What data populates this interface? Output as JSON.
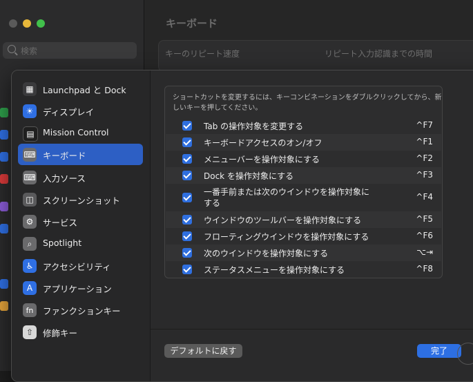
{
  "background": {
    "search_placeholder": "検索",
    "title": "キーボード",
    "label_repeat": "キーのリピート速度",
    "label_delay": "リピート入力認識までの時間"
  },
  "sidebar": {
    "items": [
      {
        "label": "Launchpad と Dock",
        "icon": "launchpad-icon",
        "color": "#3a3a3c",
        "glyph": "▦"
      },
      {
        "label": "ディスプレイ",
        "icon": "display-icon",
        "color": "#2f6fe3",
        "glyph": "☀"
      },
      {
        "label": "Mission Control",
        "icon": "mission-control-icon",
        "color": "#1f1f1f",
        "glyph": "▤"
      },
      {
        "label": "キーボード",
        "icon": "keyboard-icon",
        "color": "#6a6a6c",
        "glyph": "⌨",
        "selected": true
      },
      {
        "label": "入力ソース",
        "icon": "input-sources-icon",
        "color": "#6a6a6c",
        "glyph": "⌨"
      },
      {
        "label": "スクリーンショット",
        "icon": "screenshot-icon",
        "color": "#5a5a5c",
        "glyph": "◫"
      },
      {
        "label": "サービス",
        "icon": "services-icon",
        "color": "#6a6a6c",
        "glyph": "⚙"
      },
      {
        "label": "Spotlight",
        "icon": "spotlight-icon",
        "color": "#6a6a6c",
        "glyph": "⌕"
      },
      {
        "label": "アクセシビリティ",
        "icon": "accessibility-icon",
        "color": "#2f6fe3",
        "glyph": "♿"
      },
      {
        "label": "アプリケーション",
        "icon": "applications-icon",
        "color": "#2f6fe3",
        "glyph": "A"
      },
      {
        "label": "ファンクションキー",
        "icon": "function-keys-icon",
        "color": "#6a6a6c",
        "glyph": "fn"
      },
      {
        "label": "修飾キー",
        "icon": "modifier-keys-icon",
        "color": "#d8d8d8",
        "glyph": "⇧"
      }
    ]
  },
  "description": "ショートカットを変更するには、キーコンビネーションをダブルクリックしてから、新しいキーを押してください。",
  "shortcuts": [
    {
      "label": "Tab の操作対象を変更する",
      "key": "^F7",
      "checked": true
    },
    {
      "label": "キーボードアクセスのオン/オフ",
      "key": "^F1",
      "checked": true
    },
    {
      "label": "メニューバーを操作対象にする",
      "key": "^F2",
      "checked": true
    },
    {
      "label": "Dock を操作対象にする",
      "key": "^F3",
      "checked": true
    },
    {
      "label": "一番手前または次のウインドウを操作対象にする",
      "key": "^F4",
      "checked": true
    },
    {
      "label": "ウインドウのツールバーを操作対象にする",
      "key": "^F5",
      "checked": true
    },
    {
      "label": "フローティングウインドウを操作対象にする",
      "key": "^F6",
      "checked": true
    },
    {
      "label": "次のウインドウを操作対象にする",
      "key": "⌥⇥",
      "checked": true
    },
    {
      "label": "ステータスメニューを操作対象にする",
      "key": "^F8",
      "checked": true
    }
  ],
  "buttons": {
    "restore_defaults": "デフォルトに戻す",
    "done": "完了"
  }
}
